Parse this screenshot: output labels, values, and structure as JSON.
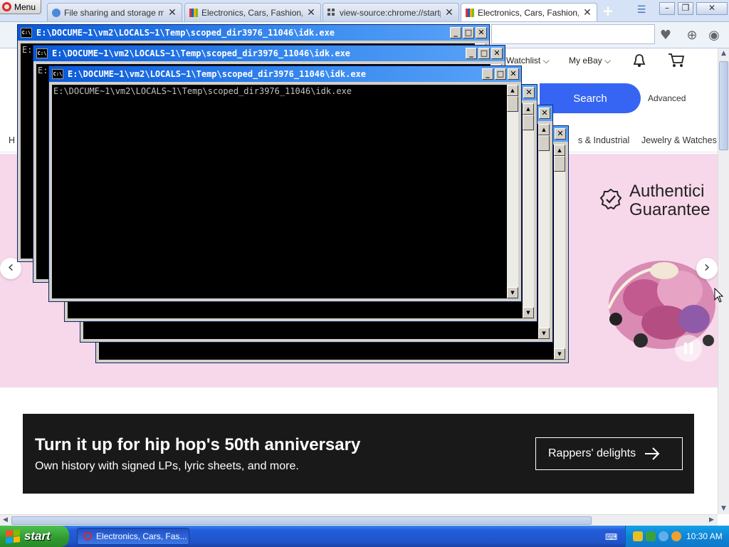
{
  "browser": {
    "menu_label": "Menu",
    "tabs": [
      {
        "label": "File sharing and storage mad…",
        "icon": "cloud"
      },
      {
        "label": "Electronics, Cars, Fashion, C…",
        "icon": "ebay"
      },
      {
        "label": "view-source:chrome://startp…",
        "icon": "grid"
      },
      {
        "label": "Electronics, Cars, Fashion, C…",
        "icon": "ebay",
        "active": true
      }
    ]
  },
  "ebay": {
    "header_links": {
      "watchlist": "Watchlist",
      "my_ebay": "My eBay"
    },
    "search_button": "Search",
    "advanced": "Advanced",
    "categories": [
      "H",
      "s & Industrial",
      "Jewelry & Watches"
    ],
    "hero": {
      "title_line1": "Authentici",
      "title_line2": "Guarantee"
    },
    "promo": {
      "title": "Turn it up for hip hop's 50th anniversary",
      "subtitle": "Own history with signed LPs, lyric sheets, and more.",
      "button": "Rappers' delights"
    }
  },
  "console": {
    "title": "E:\\DOCUME~1\\vm2\\LOCALS~1\\Temp\\scoped_dir3976_11046\\idk.exe",
    "output": "E:\\DOCUME~1\\vm2\\LOCALS~1\\Temp\\scoped_dir3976_11046\\idk.exe",
    "partial_line": "E:"
  },
  "taskbar": {
    "start": "start",
    "task_item": "Electronics, Cars, Fas...",
    "clock": "10:30 AM"
  }
}
